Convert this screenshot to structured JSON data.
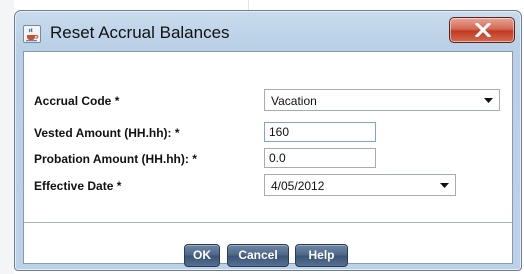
{
  "dialog": {
    "title": "Reset Accrual Balances",
    "title_icon": "java-cup-icon",
    "close_icon": "close-icon"
  },
  "form": {
    "accrual_code_label": "Accrual Code *",
    "accrual_code_value": "Vacation",
    "vested_amount_label": "Vested Amount (HH.hh): *",
    "vested_amount_value": "160",
    "probation_amount_label": "Probation Amount (HH.hh): *",
    "probation_amount_value": "0.0",
    "effective_date_label": "Effective Date *",
    "effective_date_value": "4/05/2012"
  },
  "buttons": {
    "ok": "OK",
    "cancel": "Cancel",
    "help": "Help"
  },
  "colors": {
    "frame": "#bcd2e8",
    "close_button": "#c13b24",
    "button": "#4c6686"
  }
}
